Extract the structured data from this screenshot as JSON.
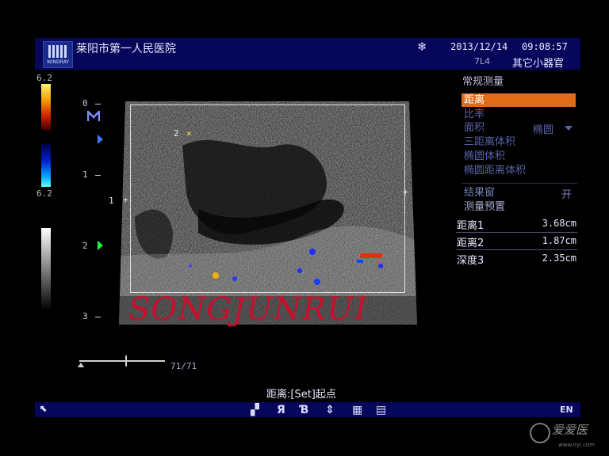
{
  "header": {
    "logo_brand": "WINDRAY",
    "hospital": "莱阳市第一人民医院",
    "date": "2013/12/14",
    "time": "09:08:57",
    "probe": "7L4",
    "exam": "其它小器官",
    "freeze_icon": "snowflake-icon"
  },
  "scale": {
    "color_max": "6.2",
    "color_min": "6.2",
    "depth_labels": [
      "0",
      "1",
      "2",
      "3"
    ]
  },
  "markers": {
    "m1": "1",
    "m2": "2"
  },
  "watermark": "SONGJUNRUI",
  "cine": {
    "frame": "71/71",
    "position": 0.55
  },
  "menu": {
    "title": "常规测量",
    "items": [
      "距离",
      "比率",
      "面积",
      "三距离体积",
      "椭圆体积",
      "椭圆距离体积"
    ],
    "area_mode": "椭圆",
    "result_window_label": "结果窗",
    "result_window_state": "开",
    "preset": "测量预置"
  },
  "results": [
    {
      "label": "距离1",
      "value": "3.68cm"
    },
    {
      "label": "距离2",
      "value": "1.87cm"
    },
    {
      "label": "深度3",
      "value": "2.35cm"
    }
  ],
  "status": "距离:[Set]起点",
  "toolbar": {
    "lang": "EN"
  },
  "site": {
    "logo": "爱爱医",
    "url": "www.iiyi.com"
  }
}
